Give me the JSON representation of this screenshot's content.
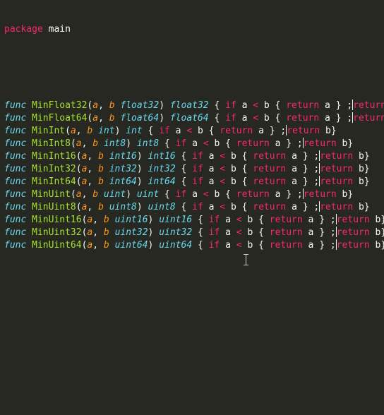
{
  "editor": {
    "package_line": {
      "keyword": "package",
      "name": " main"
    },
    "functions": [
      {
        "name": "MinFloat32",
        "type": "float32",
        "pre_pad": " ",
        "post_pad": " "
      },
      {
        "name": "MinFloat64",
        "type": "float64",
        "pre_pad": " ",
        "post_pad": " "
      },
      {
        "name": "MinInt",
        "type": "int",
        "pre_pad": " ",
        "post_pad": ""
      },
      {
        "name": "MinInt8",
        "type": "int8",
        "pre_pad": " ",
        "post_pad": ""
      },
      {
        "name": "MinInt16",
        "type": "int16",
        "pre_pad": " ",
        "post_pad": ""
      },
      {
        "name": "MinInt32",
        "type": "int32",
        "pre_pad": " ",
        "post_pad": ""
      },
      {
        "name": "MinInt64",
        "type": "int64",
        "pre_pad": " ",
        "post_pad": ""
      },
      {
        "name": "MinUint",
        "type": "uint",
        "pre_pad": " ",
        "post_pad": ""
      },
      {
        "name": "MinUint8",
        "type": "uint8",
        "pre_pad": " ",
        "post_pad": ""
      },
      {
        "name": "MinUint16",
        "type": "uint16",
        "pre_pad": " ",
        "post_pad": ""
      },
      {
        "name": "MinUint32",
        "type": "uint32",
        "pre_pad": " ",
        "post_pad": ""
      },
      {
        "name": "MinUint64",
        "type": "uint64",
        "pre_pad": " ",
        "post_pad": ""
      }
    ],
    "tokens": {
      "func": "func",
      "param_a": "a",
      "param_b": "b",
      "if": "if",
      "lt": "<",
      "return": "return",
      "ret_a": "a",
      "ret_b": "b"
    },
    "colors": {
      "background": "#272822",
      "keyword": "#f92672",
      "function_name": "#a6e22e",
      "parameter": "#fd971f",
      "type": "#66d9ef",
      "plain": "#f8f8f2"
    },
    "pointer_icon": "i-beam-cursor-icon"
  }
}
